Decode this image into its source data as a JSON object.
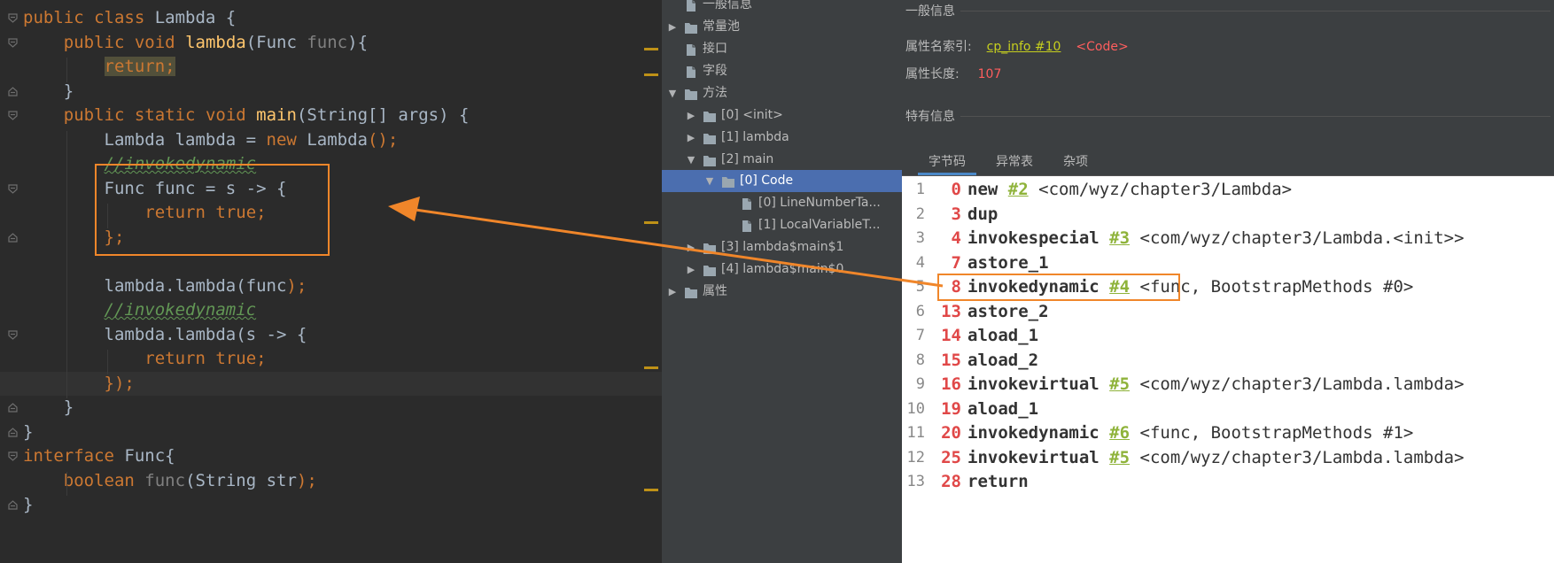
{
  "colors": {
    "editor_bg": "#2b2b2b",
    "keyword": "#cc7832",
    "method": "#ffc66d",
    "comment": "#629755",
    "panel_bg": "#3c3f41",
    "selection": "#4b6eaf",
    "annotation": "#f0862a",
    "offset_red": "#e04848",
    "ref_green": "#8fb33b"
  },
  "editor": {
    "lines": [
      {
        "t": "public class Lambda {"
      },
      {
        "t": "    public void lambda(Func func){"
      },
      {
        "t": "        return;"
      },
      {
        "t": "    }"
      },
      {
        "t": "    public static void main(String[] args) {"
      },
      {
        "t": "        Lambda lambda = new Lambda();"
      },
      {
        "t": "        //invokedynamic"
      },
      {
        "t": "        Func func = s -> {"
      },
      {
        "t": "            return true;"
      },
      {
        "t": "        };"
      },
      {
        "t": ""
      },
      {
        "t": "        lambda.lambda(func);"
      },
      {
        "t": "        //invokedynamic"
      },
      {
        "t": "        lambda.lambda(s -> {"
      },
      {
        "t": "            return true;"
      },
      {
        "t": "        });"
      },
      {
        "t": "    }"
      },
      {
        "t": "}"
      },
      {
        "t": "interface Func{"
      },
      {
        "t": "    boolean func(String str);"
      },
      {
        "t": "}"
      }
    ]
  },
  "tree": {
    "items": [
      {
        "label": "一般信息",
        "icon": "file-icon"
      },
      {
        "label": "常量池",
        "icon": "folder-icon",
        "arrow": "collapsed"
      },
      {
        "label": "接口",
        "icon": "file-icon"
      },
      {
        "label": "字段",
        "icon": "file-icon"
      },
      {
        "label": "方法",
        "icon": "folder-icon",
        "arrow": "expanded"
      },
      {
        "label": "[0] <init>",
        "icon": "folder-icon",
        "arrow": "collapsed"
      },
      {
        "label": "[1] lambda",
        "icon": "folder-icon",
        "arrow": "collapsed"
      },
      {
        "label": "[2] main",
        "icon": "folder-icon",
        "arrow": "expanded"
      },
      {
        "label": "[0] Code",
        "icon": "folder-icon",
        "arrow": "expanded",
        "selected": true
      },
      {
        "label": "[0] LineNumberTa...",
        "icon": "file-icon"
      },
      {
        "label": "[1] LocalVariableT...",
        "icon": "file-icon"
      },
      {
        "label": "[3] lambda$main$1",
        "icon": "folder-icon",
        "arrow": "collapsed"
      },
      {
        "label": "[4] lambda$main$0",
        "icon": "folder-icon",
        "arrow": "collapsed"
      },
      {
        "label": "属性",
        "icon": "folder-icon",
        "arrow": "collapsed"
      }
    ]
  },
  "detail": {
    "general_title": "一般信息",
    "attr_name_label": "属性名索引:",
    "attr_name_link": "cp_info #10",
    "attr_name_value": "<Code>",
    "attr_len_label": "属性长度:",
    "attr_len_value": "107",
    "specific_title": "特有信息",
    "tabs": [
      "字节码",
      "异常表",
      "杂项"
    ]
  },
  "bytecode": [
    {
      "n": "1",
      "off": "0",
      "op": "new",
      "ref": "#2",
      "cmt": "<com/wyz/chapter3/Lambda>"
    },
    {
      "n": "2",
      "off": "3",
      "op": "dup",
      "ref": "",
      "cmt": ""
    },
    {
      "n": "3",
      "off": "4",
      "op": "invokespecial",
      "ref": "#3",
      "cmt": "<com/wyz/chapter3/Lambda.<init>>"
    },
    {
      "n": "4",
      "off": "7",
      "op": "astore_1",
      "ref": "",
      "cmt": ""
    },
    {
      "n": "5",
      "off": "8",
      "op": "invokedynamic",
      "ref": "#4",
      "cmt": "<func, BootstrapMethods #0>"
    },
    {
      "n": "6",
      "off": "13",
      "op": "astore_2",
      "ref": "",
      "cmt": ""
    },
    {
      "n": "7",
      "off": "14",
      "op": "aload_1",
      "ref": "",
      "cmt": ""
    },
    {
      "n": "8",
      "off": "15",
      "op": "aload_2",
      "ref": "",
      "cmt": ""
    },
    {
      "n": "9",
      "off": "16",
      "op": "invokevirtual",
      "ref": "#5",
      "cmt": "<com/wyz/chapter3/Lambda.lambda>"
    },
    {
      "n": "10",
      "off": "19",
      "op": "aload_1",
      "ref": "",
      "cmt": ""
    },
    {
      "n": "11",
      "off": "20",
      "op": "invokedynamic",
      "ref": "#6",
      "cmt": "<func, BootstrapMethods #1>"
    },
    {
      "n": "12",
      "off": "25",
      "op": "invokevirtual",
      "ref": "#5",
      "cmt": "<com/wyz/chapter3/Lambda.lambda>"
    },
    {
      "n": "13",
      "off": "28",
      "op": "return",
      "ref": "",
      "cmt": ""
    }
  ]
}
